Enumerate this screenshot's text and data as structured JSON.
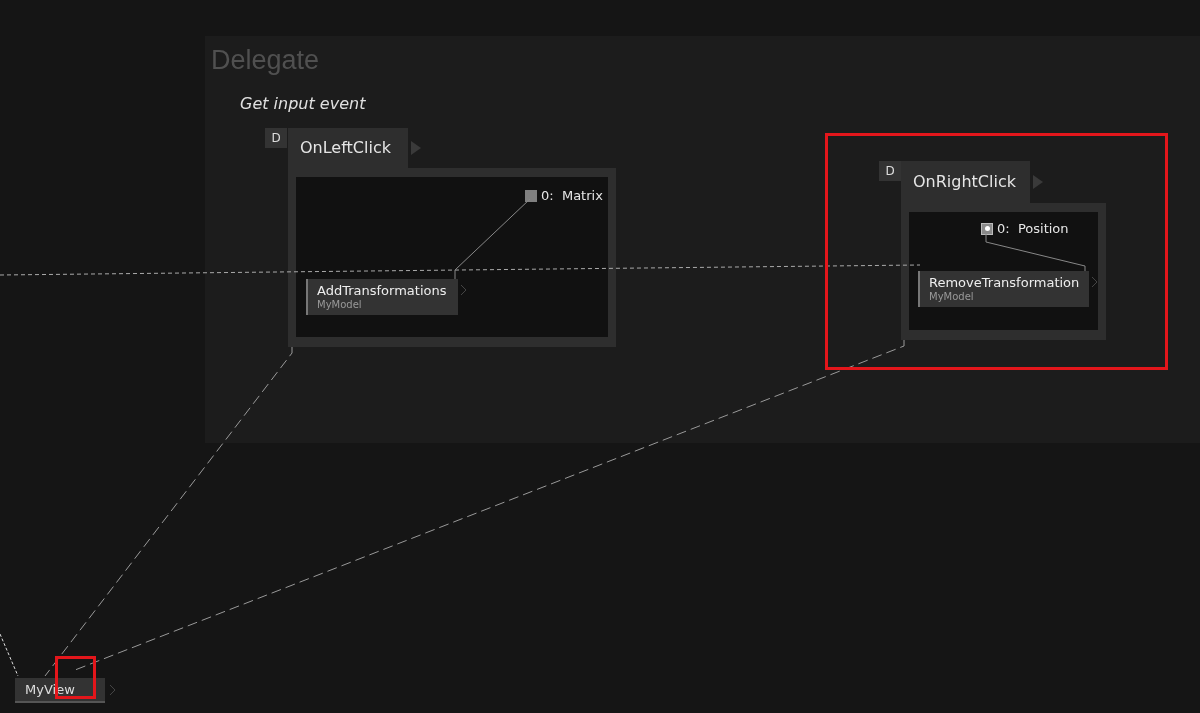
{
  "region": {
    "title": "Delegate",
    "comment": "Get input event"
  },
  "delegates": [
    {
      "badge": "D",
      "name": "OnLeftClick",
      "pin": {
        "kind": "square",
        "label": "0:  Matrix"
      },
      "node": {
        "name": "AddTransformations",
        "category": "MyModel"
      }
    },
    {
      "badge": "D",
      "name": "OnRightClick",
      "pin": {
        "kind": "dot",
        "label": "0:  Position"
      },
      "node": {
        "name": "RemoveTransformation",
        "category": "MyModel"
      }
    }
  ],
  "bottom_node": {
    "name": "MyView"
  }
}
